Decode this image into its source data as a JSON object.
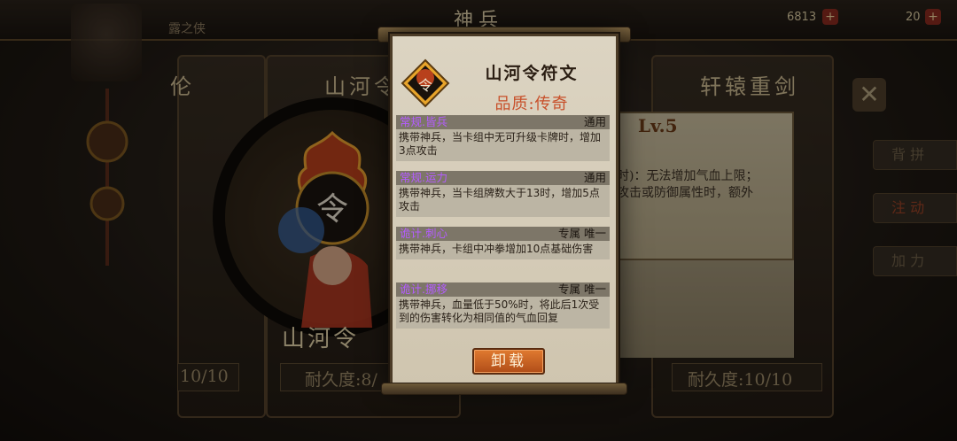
{
  "header": {
    "left_text": "露之侠",
    "title": "神兵",
    "resource_value": "6813",
    "resource_value_2": "20"
  },
  "background": {
    "left_card_title": "伦",
    "center_card_title": "山河令",
    "right_card_title": "轩辕重剑",
    "left_durability": "10/10",
    "center_durability": "耐久度:8/",
    "right_durability": "耐久度:10/10",
    "weapon_name": "山河令",
    "right_level": "Lv.5",
    "right_desc": "时)：无法增加气血上限；\n攻击或防御属性时，额外",
    "right_tabs": [
      "背 拼",
      "注 动",
      "加 力"
    ]
  },
  "modal": {
    "title": "山河令符文",
    "quality": "品质:传奇",
    "emblem_char": "令",
    "runes": [
      {
        "name": "常规.皆兵",
        "tag": "通用",
        "desc": "携带神兵，当卡组中无可升级卡牌时，增加3点攻击"
      },
      {
        "name": "常规.运力",
        "tag": "通用",
        "desc": "携带神兵，当卡组牌数大于13时，增加5点攻击"
      },
      {
        "name": "诡计.刺心",
        "tag": "专属 唯一",
        "desc": "携带神兵，卡组中冲拳增加10点基础伤害"
      },
      {
        "name": "诡计.挪移",
        "tag": "专属 唯一",
        "desc": "携带神兵，血量低于50%时，将此后1次受到的伤害转化为相同值的气血回复"
      }
    ],
    "unload_label": "卸载"
  },
  "colors": {
    "rune_name": "#b45cff",
    "quality": "#c8502a",
    "button": "#c8602a"
  }
}
